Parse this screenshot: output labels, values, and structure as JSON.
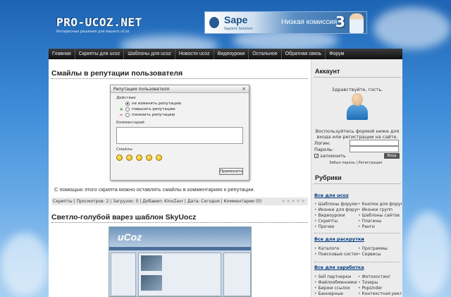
{
  "header": {
    "logo": "PRO-UCOZ.NET",
    "logo_sub": "Интересные решения для вашего uCoz",
    "banner": {
      "title": "Sape",
      "subtitle": "Sapient Solution",
      "text": "Низкая комиссия",
      "number": "3"
    }
  },
  "nav": {
    "items": [
      "Главная",
      "Скрипты для ucoz",
      "Шаблоны для ucoz",
      "Новости ucoz",
      "Видеоуроки",
      "Остальное",
      "Обратная связь",
      "Форум"
    ]
  },
  "posts": [
    {
      "title": "Смайлы в репутации пользователя",
      "description": "С помощью этого скрипта можно оставлять смайлы в комментариях к репутации.",
      "meta": "Скрипты | Просмотров: 2 | Загрузок: 0 | Добавил: KinoZavr | Дата: Сегодня | Комментарии (0)"
    },
    {
      "title": "Светло-голубой варез шаблон SkyUocz"
    }
  ],
  "dialog": {
    "title": "Репутация пользователя",
    "action_label": "Действие",
    "options": [
      "не изменять репутацию",
      "повысить репутацию",
      "понизить репутацию"
    ],
    "comment_label": "Комментарий",
    "smileys_label": "Смайлы",
    "apply": "Применить"
  },
  "screenshot_logo": "uCoz",
  "sidebar": {
    "account": {
      "title": "Аккаунт",
      "greeting": "Здравствуйте, гость.",
      "hint": "Воспользуйтесь формой ниже для входа или регистрации на сайте.",
      "login_label": "Логин:",
      "password_label": "Пароль:",
      "remember": "запомнить",
      "login_button": "Вход",
      "links": "Забыл пароль | Регистрация"
    },
    "rubrics": {
      "title": "Рубрики",
      "groups": [
        {
          "title": "Все для ucoz",
          "items": [
            "Шаблоны форумов",
            "Кнопки для форума",
            "Иконки для форума",
            "Иконки групп",
            "Видеоуроки",
            "Шаблоны сайтов",
            "Скрипты",
            "Плагины",
            "Прочее",
            "Ранги"
          ]
        },
        {
          "title": "Все для раскрутки",
          "items": [
            "Каталоги",
            "Программы",
            "Поисковые системы",
            "Сервисы"
          ]
        },
        {
          "title": "Все для заработка",
          "items": [
            "Sell партнерки",
            "Фотохостинг",
            "Файлообменники",
            "Тизеры",
            "Биржи ссылок",
            "PopUnder",
            "Баннерные",
            "Контекстная реклама"
          ]
        }
      ]
    }
  }
}
